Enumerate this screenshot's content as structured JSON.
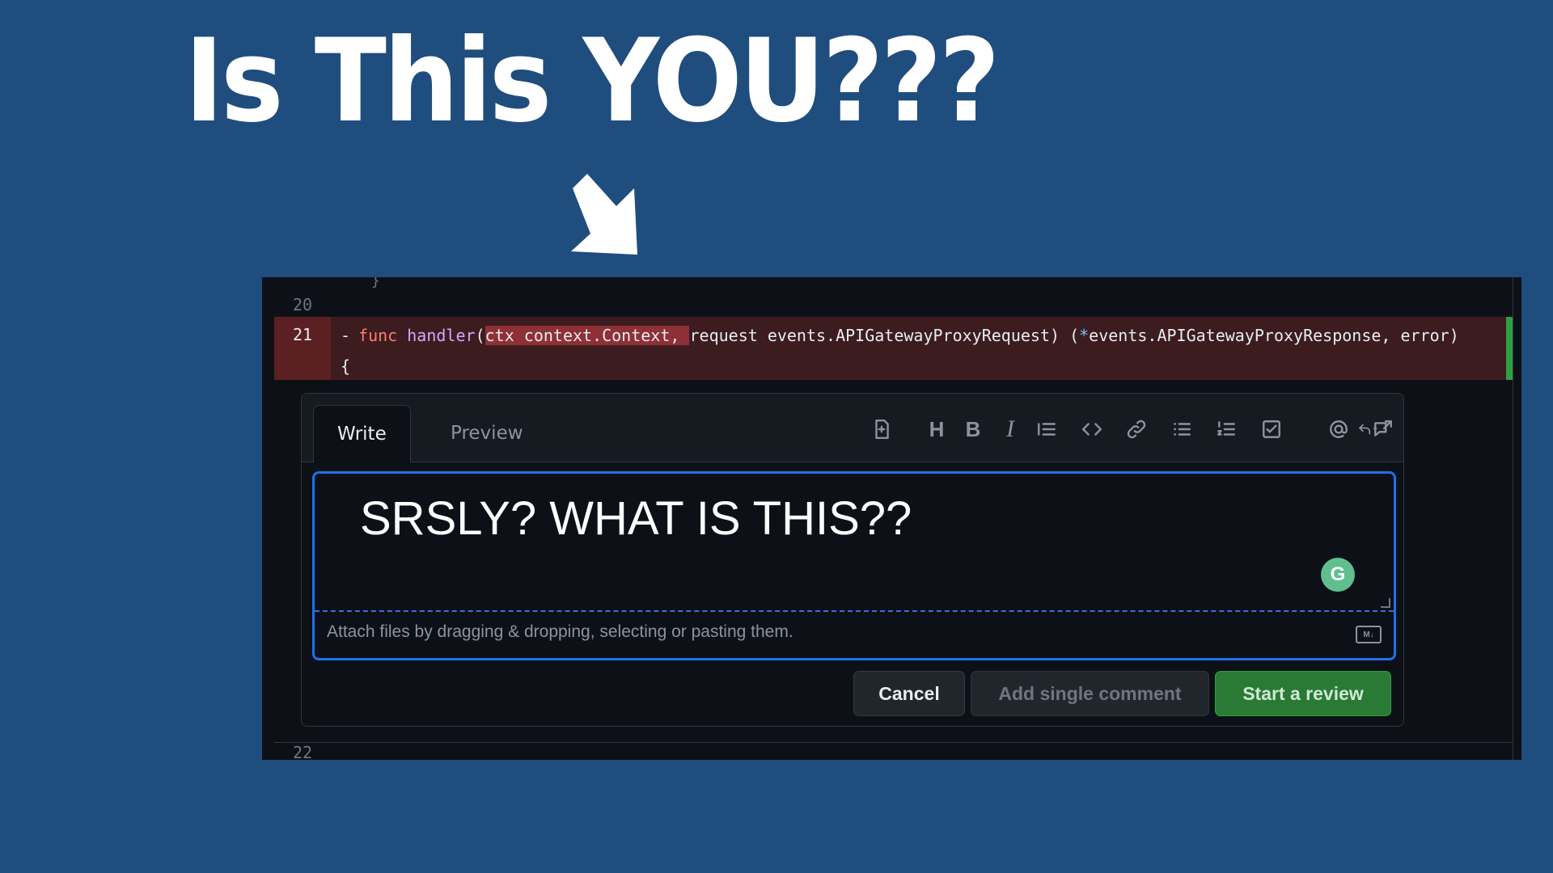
{
  "slide": {
    "title": "Is This YOU???"
  },
  "diff": {
    "cut_text": "}",
    "line_20": "20",
    "line_21": "21",
    "line_22": "22",
    "code": {
      "minus": "-",
      "kw": "func",
      "fn": "handler",
      "paren": "(",
      "highlight": "ctx context.Context, ",
      "rest": "request events.APIGatewayProxyRequest) (",
      "star": "*",
      "rest2": "events.APIGatewayProxyResponse, error) {"
    }
  },
  "comment": {
    "tabs": {
      "write": "Write",
      "preview": "Preview"
    },
    "toolbar": [
      "add-file-icon",
      "heading-icon",
      "bold-icon",
      "italic-icon",
      "quote-icon",
      "code-icon",
      "link-icon",
      "bulleted-list-icon",
      "numbered-list-icon",
      "task-list-icon",
      "mention-icon",
      "cross-reference-icon",
      "undo-icon"
    ],
    "toolbar_labels": {
      "heading": "H",
      "bold": "B",
      "italic": "I"
    },
    "editor_text": "SRSLY? WHAT IS THIS??",
    "grammarly": "G",
    "attach_text": "Attach files by dragging & dropping, selecting or pasting them.",
    "md_badge": "M↓",
    "buttons": {
      "cancel": "Cancel",
      "single": "Add single comment",
      "review": "Start a review"
    }
  },
  "colors": {
    "background": "#1f4d7e",
    "deleted_row": "#3d1c1f",
    "accent": "#1f6feb",
    "review_button": "#2a7a35"
  }
}
